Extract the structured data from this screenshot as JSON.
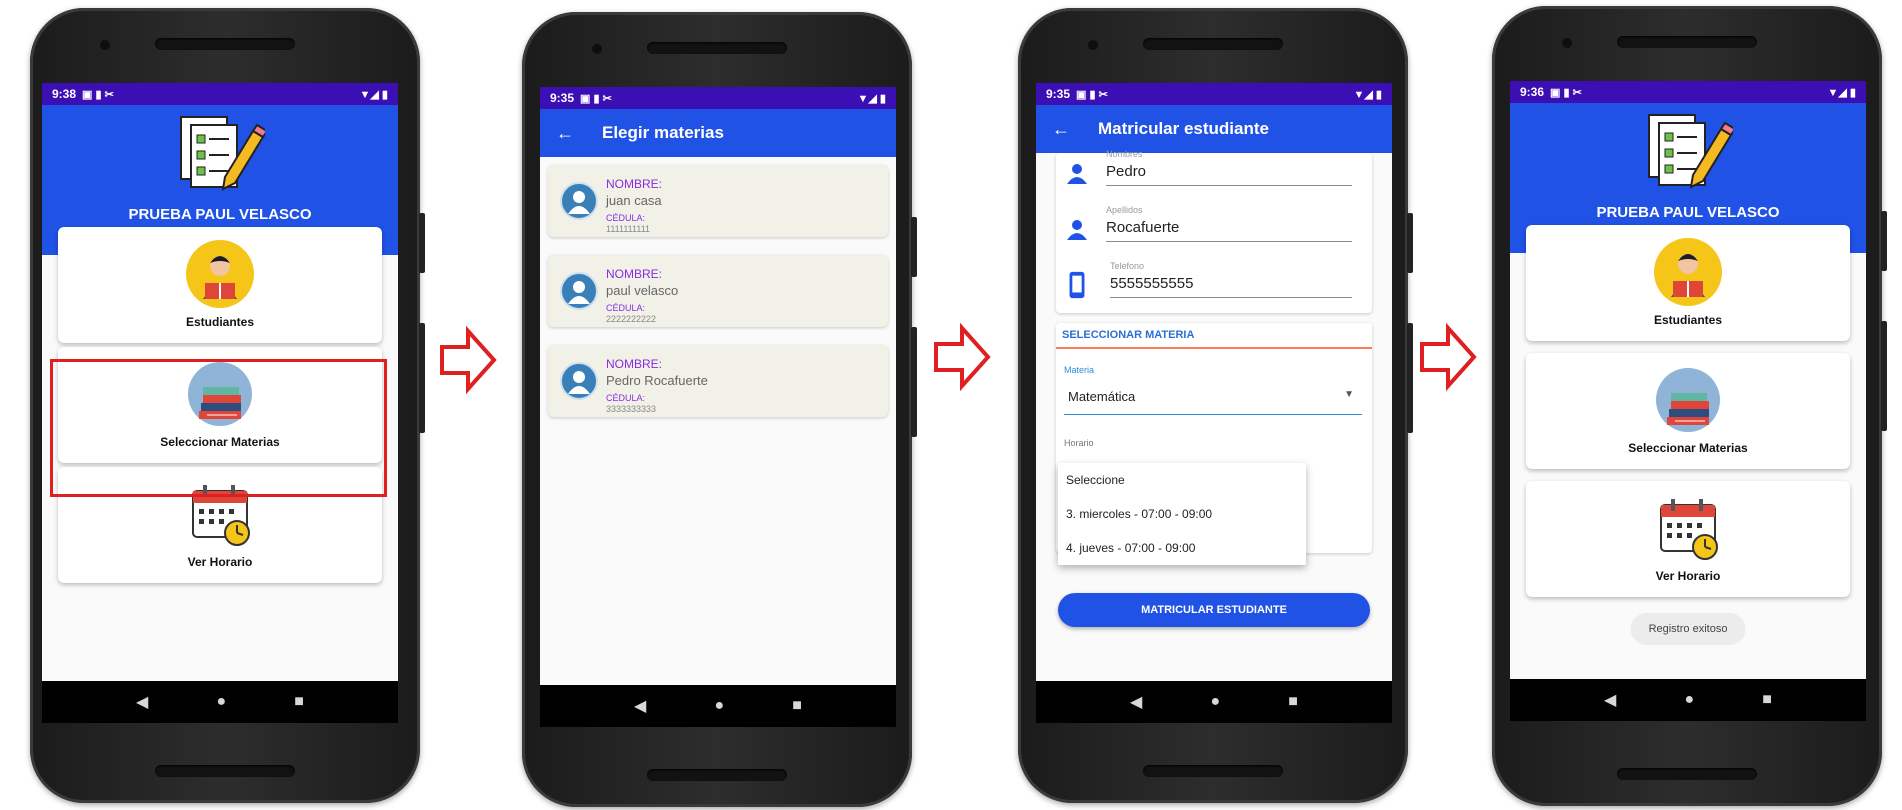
{
  "screens": [
    {
      "time": "9:38",
      "title": "PRUEBA PAUL VELASCO",
      "menu": [
        {
          "label": "Estudiantes"
        },
        {
          "label": "Seleccionar Materias"
        },
        {
          "label": "Ver Horario"
        }
      ]
    },
    {
      "time": "9:35",
      "appbar_title": "Elegir materias",
      "students": [
        {
          "name_key": "NOMBRE:",
          "name": "juan casa",
          "id_key": "CÉDULA:",
          "id": "1111111111"
        },
        {
          "name_key": "NOMBRE:",
          "name": "paul velasco",
          "id_key": "CÉDULA:",
          "id": "2222222222"
        },
        {
          "name_key": "NOMBRE:",
          "name": "Pedro Rocafuerte",
          "id_key": "CÉDULA:",
          "id": "3333333333"
        }
      ]
    },
    {
      "time": "9:35",
      "appbar_title": "Matricular estudiante",
      "fields": [
        {
          "label": "Nombres",
          "value": "Pedro"
        },
        {
          "label": "Apellidos",
          "value": "Rocafuerte"
        },
        {
          "label": "Telefono",
          "value": "5555555555"
        }
      ],
      "section_title": "SELECCIONAR MATERIA",
      "materia_label": "Materia",
      "materia_value": "Matemática",
      "horario_label": "Horario",
      "horario_options": [
        "Seleccione",
        "3. miercoles - 07:00 - 09:00",
        "4. jueves - 07:00 - 09:00"
      ],
      "submit_label": "MATRICULAR ESTUDIANTE"
    },
    {
      "time": "9:36",
      "title": "PRUEBA PAUL VELASCO",
      "menu": [
        {
          "label": "Estudiantes"
        },
        {
          "label": "Seleccionar Materias"
        },
        {
          "label": "Ver Horario"
        }
      ],
      "toast": "Registro exitoso"
    }
  ],
  "colors": {
    "primary": "#2052e6",
    "status": "#3c0fb5",
    "arrow": "#e02020",
    "accent_purple": "#8a2be2"
  },
  "icons": [
    "checklist-logo-icon",
    "student-reading-icon",
    "books-icon",
    "calendar-clock-icon",
    "person-icon",
    "phone-icon",
    "back-arrow-icon",
    "dropdown-arrow-icon",
    "red-outline-arrow-icon"
  ]
}
